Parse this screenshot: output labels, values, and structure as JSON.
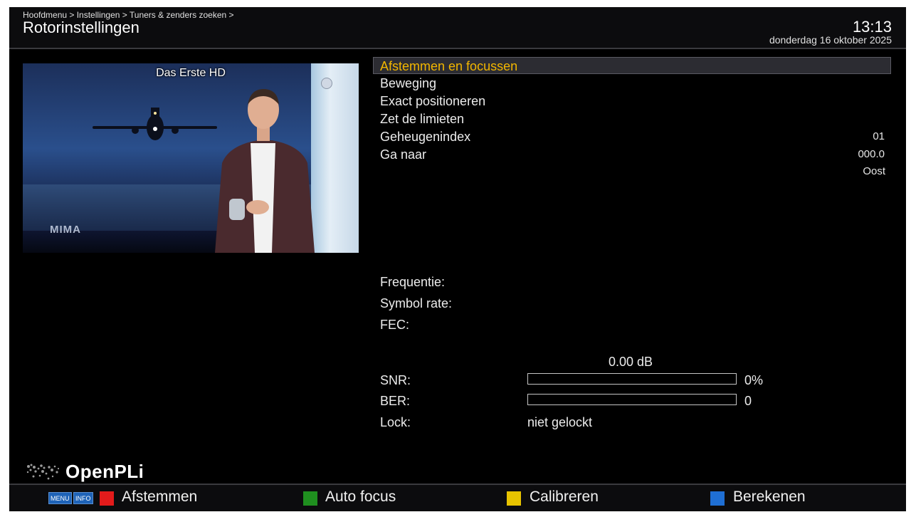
{
  "header": {
    "breadcrumb": "Hoofdmenu > Instellingen > Tuners & zenders zoeken >",
    "title": "Rotorinstellingen",
    "time": "13:13",
    "date": "donderdag 16 oktober 2025"
  },
  "preview": {
    "channel_name": "Das Erste HD",
    "watermark": "MIMA"
  },
  "menu": {
    "items": [
      {
        "label": "Afstemmen en focussen",
        "value": ""
      },
      {
        "label": "Beweging",
        "value": ""
      },
      {
        "label": "Exact positioneren",
        "value": ""
      },
      {
        "label": "Zet de limieten",
        "value": ""
      },
      {
        "label": "Geheugenindex",
        "value": "01"
      },
      {
        "label": "Ga naar",
        "value": "000.0"
      }
    ],
    "goto_direction": "Oost",
    "selected_index": 0
  },
  "tuning": {
    "frequency_label": "Frequentie:",
    "symbol_rate_label": "Symbol rate:",
    "fec_label": "FEC:"
  },
  "signal": {
    "db": "0.00 dB",
    "snr_label": "SNR:",
    "snr_value": "0%",
    "snr_fraction": 0,
    "ber_label": "BER:",
    "ber_value": "0",
    "ber_fraction": 0,
    "lock_label": "Lock:",
    "lock_value": "niet gelockt"
  },
  "brand": {
    "name": "OpenPLi"
  },
  "footer": {
    "menu_key": "MENU",
    "info_key": "INFO",
    "red_label": "Afstemmen",
    "green_label": "Auto focus",
    "yellow_label": "Calibreren",
    "blue_label": "Berekenen",
    "colors": {
      "red": "#e31b1b",
      "green": "#1f8f1f",
      "yellow": "#e8c400",
      "blue": "#1f6fd4"
    }
  },
  "colors": {
    "background": "#000000",
    "selected_text": "#f2b600",
    "text": "#ececec"
  }
}
